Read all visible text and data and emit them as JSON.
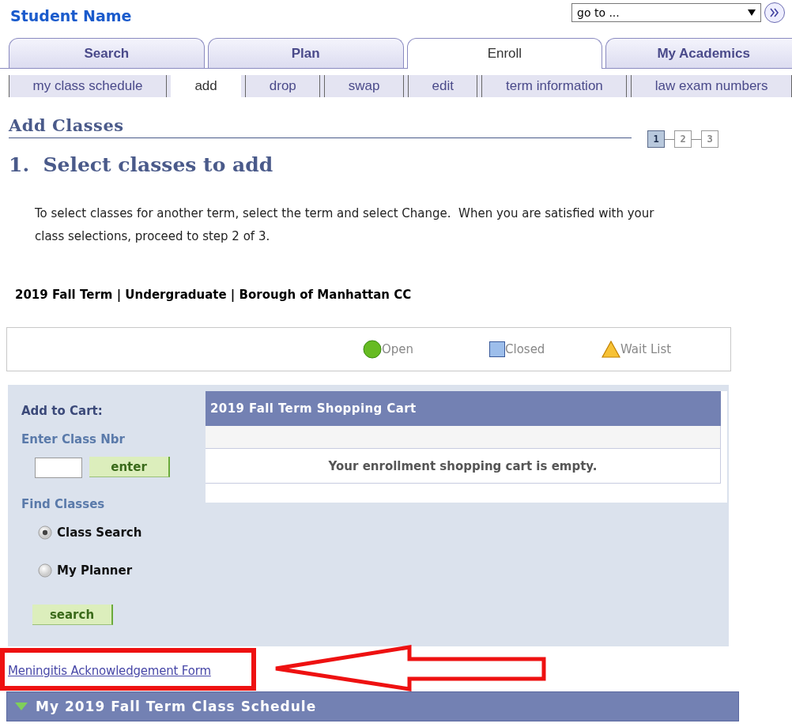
{
  "student_name": "Student Name",
  "goto": {
    "value": "go to ..."
  },
  "tabs": [
    {
      "label": "Search",
      "selected": false
    },
    {
      "label": "Plan",
      "selected": false
    },
    {
      "label": "Enroll",
      "selected": true
    },
    {
      "label": "My Academics",
      "selected": false
    }
  ],
  "subtabs": [
    {
      "label": "my class schedule",
      "selected": false
    },
    {
      "label": "add",
      "selected": true
    },
    {
      "label": "drop",
      "selected": false
    },
    {
      "label": "swap",
      "selected": false
    },
    {
      "label": "edit",
      "selected": false
    },
    {
      "label": "term information",
      "selected": false
    },
    {
      "label": "law exam numbers",
      "selected": false
    }
  ],
  "page_title": "Add Classes",
  "steps": [
    {
      "label": "1",
      "selected": true
    },
    {
      "label": "2",
      "selected": false
    },
    {
      "label": "3",
      "selected": false
    }
  ],
  "step_heading": "1.  Select classes to add",
  "instructions": "To select classes for another term, select the term and select Change.  When you are satisfied with your class selections, proceed to step 2 of 3.",
  "term_line": "2019 Fall Term | Undergraduate | Borough of Manhattan CC",
  "legend": [
    {
      "kind": "circle",
      "label": "Open",
      "color": "#66bb22"
    },
    {
      "kind": "square",
      "label": "Closed",
      "color": "#9dbeeb"
    },
    {
      "kind": "triangle",
      "label": "Wait List",
      "color": "#f7c236"
    }
  ],
  "add_to_cart": {
    "heading": "Add to Cart:",
    "enter_label": "Enter Class Nbr",
    "enter_button": "enter",
    "find_label": "Find Classes",
    "options": [
      {
        "label": "Class Search",
        "selected": true
      },
      {
        "label": "My Planner",
        "selected": false
      }
    ],
    "search_button": "search"
  },
  "cart": {
    "title": "2019 Fall Term Shopping Cart",
    "message": "Your enrollment shopping cart is empty."
  },
  "link": "Meningitis Acknowledgement Form",
  "schedule": {
    "title": "My 2019 Fall Term Class Schedule",
    "expanded": true
  }
}
